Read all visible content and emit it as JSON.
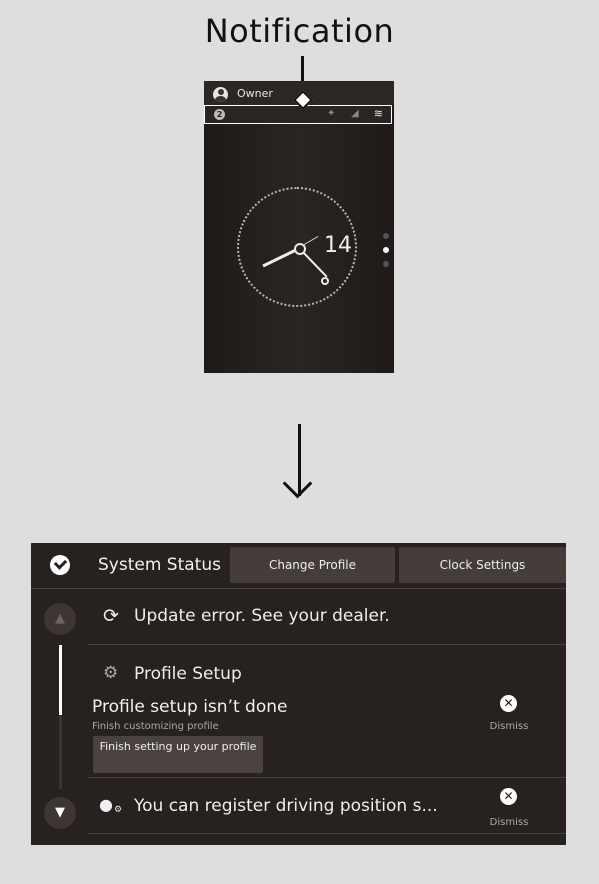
{
  "heading": "Notification",
  "phone": {
    "owner_label": "Owner",
    "notification_count": "2",
    "status_icons": [
      "satellite-icon",
      "signal-icon",
      "wifi-icon"
    ],
    "clock_day": "14"
  },
  "header": {
    "title": "System Status",
    "change_profile_label": "Change Profile",
    "clock_settings_label": "Clock Settings"
  },
  "notifications": {
    "update_error_text": "Update error. See your dealer.",
    "profile_setup": {
      "title": "Profile Setup",
      "heading": "Profile setup isn’t done",
      "subtext": "Finish customizing profile",
      "button_label": "Finish setting up your profile",
      "dismiss_label": "Dismiss"
    },
    "driving_position": {
      "text": "You can register driving position s...",
      "dismiss_label": "Dismiss"
    }
  }
}
